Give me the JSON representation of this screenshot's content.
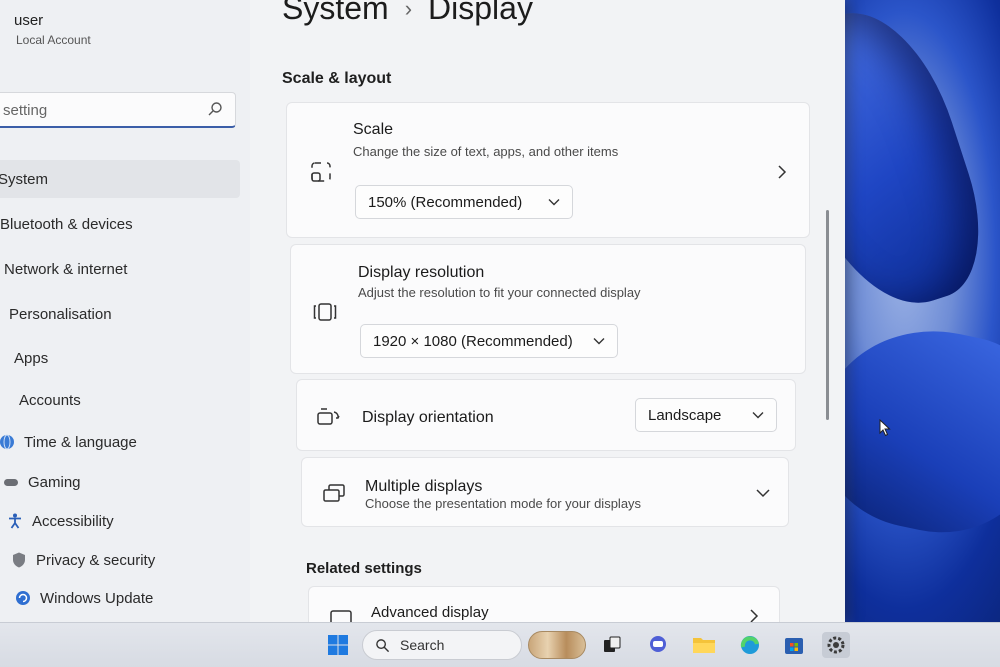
{
  "user": {
    "name": "user",
    "account_type": "Local Account"
  },
  "search": {
    "placeholder": "setting"
  },
  "nav": {
    "items": [
      {
        "label": "System",
        "icon": "system-icon",
        "active": true
      },
      {
        "label": "Bluetooth & devices",
        "icon": "bluetooth-icon"
      },
      {
        "label": "Network & internet",
        "icon": "wifi-icon"
      },
      {
        "label": "Personalisation",
        "icon": "brush-icon"
      },
      {
        "label": "Apps",
        "icon": "apps-icon"
      },
      {
        "label": "Accounts",
        "icon": "person-icon"
      },
      {
        "label": "Time & language",
        "icon": "globe-icon"
      },
      {
        "label": "Gaming",
        "icon": "gamepad-icon"
      },
      {
        "label": "Accessibility",
        "icon": "accessibility-icon"
      },
      {
        "label": "Privacy & security",
        "icon": "shield-icon"
      },
      {
        "label": "Windows Update",
        "icon": "update-icon"
      }
    ]
  },
  "header": {
    "breadcrumb_parent": "System",
    "separator": "›",
    "title": "Display"
  },
  "scale_layout": {
    "section_title": "Scale & layout",
    "scale": {
      "title": "Scale",
      "description": "Change the size of text, apps, and other items",
      "value": "150% (Recommended)"
    },
    "resolution": {
      "title": "Display resolution",
      "description": "Adjust the resolution to fit your connected display",
      "value": "1920 × 1080 (Recommended)"
    },
    "orientation": {
      "title": "Display orientation",
      "value": "Landscape"
    },
    "multiple_displays": {
      "title": "Multiple displays",
      "description": "Choose the presentation mode for your displays"
    }
  },
  "related": {
    "section_title": "Related settings",
    "advanced_display": {
      "title": "Advanced display"
    }
  },
  "taskbar": {
    "search_label": "Search"
  },
  "colors": {
    "accent": "#3b5ea8",
    "window_bg": "#f2f3f5",
    "card_bg": "#fbfbfc"
  }
}
